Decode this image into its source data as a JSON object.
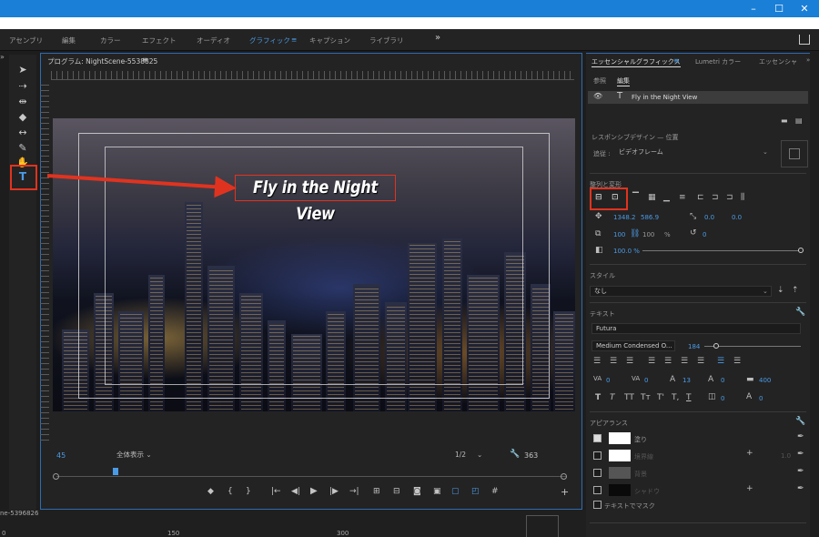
{
  "window": {
    "controls": [
      "–",
      "☐",
      "✕"
    ]
  },
  "workspaces": {
    "items": [
      "アセンブリ",
      "編集",
      "カラー",
      "エフェクト",
      "オーディオ",
      "グラフィック",
      "キャプション",
      "ライブラリ"
    ],
    "active": "グラフィック",
    "more": "»",
    "menu_glyph": "≡"
  },
  "monitor": {
    "title": "プログラム: NightScene-5538825",
    "menu_glyph": "≡",
    "overlay_title": "Fly in the Night View",
    "timecode": "45",
    "fit": "全体表示",
    "resolution": "1/2",
    "frame_value": "363"
  },
  "bottom": {
    "sequence": "ne-5396826",
    "ruler": [
      "0",
      "150",
      "300"
    ]
  },
  "essential_graphics": {
    "tabs": [
      "エッセンシャルグラフィックス",
      "Lumetri カラー",
      "エッセンシャ"
    ],
    "subtabs": [
      "参照",
      "編集"
    ],
    "layer_name": "Fly in the Night View",
    "responsive_label": "レスポンシブデザイン — 位置",
    "follow_label": "追従 :",
    "follow_value": "ビデオフレーム",
    "align_label": "整列と変形",
    "position_x": "1348.2",
    "position_y": "586.9",
    "anchor_x": "0.0",
    "anchor_y": "0.0",
    "scale_w": "100",
    "scale_h": "100",
    "scale_unit": "%",
    "rotation": "0",
    "opacity": "100.0 %",
    "style_label": "スタイル",
    "style_value": "なし",
    "text_label": "テキスト",
    "font": "Futura",
    "font_style": "Medium Condensed O...",
    "font_size": "184",
    "tracking": "0",
    "kerning": "0",
    "leading": "13",
    "baseline": "0",
    "tsume": "0",
    "tab_width": "400",
    "appearance_label": "アピアランス",
    "fill_label": "塗り",
    "stroke_label": "境界線",
    "stroke_width": "1.0",
    "bg_label": "背景",
    "shadow_label": "シャドウ",
    "mask_label": "テキストでマスク",
    "typo_buttons": [
      "T",
      "T",
      "TT",
      "Tт",
      "T'",
      "T,",
      "T"
    ]
  },
  "colors": {
    "accent": "#4a9be6",
    "highlight": "#e0331f",
    "titlebar": "#1a7fd7"
  }
}
